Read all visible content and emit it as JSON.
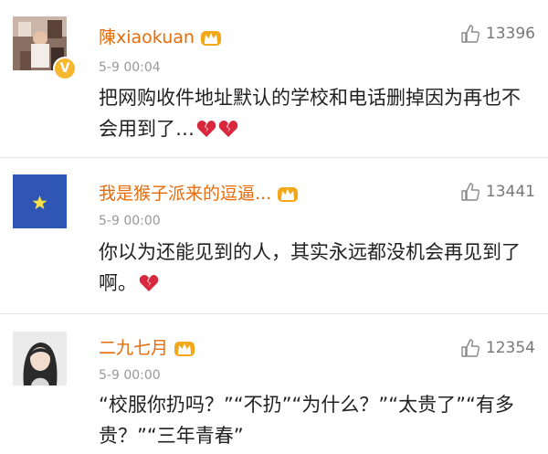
{
  "comments": [
    {
      "username": "陳xiaokuan",
      "likes": "13396",
      "time": "5-9 00:04",
      "text": "把网购收件地址默认的学校和电话删掉因为再也不会用到了…"
    },
    {
      "username": "我是猴子派来的逗逼...",
      "likes": "13441",
      "time": "5-9 00:00",
      "text": "你以为还能见到的人，其实永远都没机会再见到了啊。"
    },
    {
      "username": "二九七月",
      "likes": "12354",
      "time": "5-9 00:00",
      "text": "“校服你扔吗？”“不扔”“为什么？”“太贵了”“有多贵？”“三年青春”"
    }
  ],
  "colors": {
    "username": "#e86b0a",
    "time": "#999999",
    "verified_badge": "#f5b82e",
    "heart": "#d9283d",
    "crown": "#f2a818"
  },
  "icons": {
    "like": "thumbs-up-icon",
    "member": "crown-icon",
    "verified": "verified-badge-icon",
    "emoji": "broken-heart-icon"
  }
}
